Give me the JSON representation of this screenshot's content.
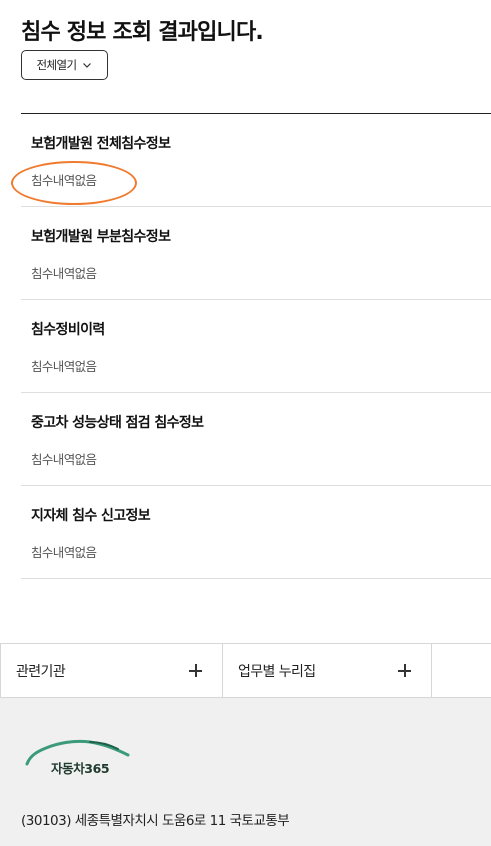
{
  "header": {
    "title": "침수 정보 조회 결과입니다.",
    "expand_all_label": "전체열기"
  },
  "results": [
    {
      "title": "보험개발원 전체침수정보",
      "status": "침수내역없음"
    },
    {
      "title": "보험개발원 부분침수정보",
      "status": "침수내역없음"
    },
    {
      "title": "침수정비이력",
      "status": "침수내역없음"
    },
    {
      "title": "중고차 성능상태 점검 침수정보",
      "status": "침수내역없음"
    },
    {
      "title": "지자체 침수 신고정보",
      "status": "침수내역없음"
    }
  ],
  "related_links": [
    {
      "label": "관련기관",
      "icon": "plus-icon"
    },
    {
      "label": "업무별 누리집",
      "icon": "plus-icon"
    }
  ],
  "footer": {
    "logo_text": "자동차365",
    "address": "(30103) 세종특별자치시 도움6로 11 국토교통부"
  },
  "colors": {
    "highlight": "#f07a2e",
    "logo_green": "#3a9a7a",
    "footer_bg": "#f0f0f0"
  }
}
